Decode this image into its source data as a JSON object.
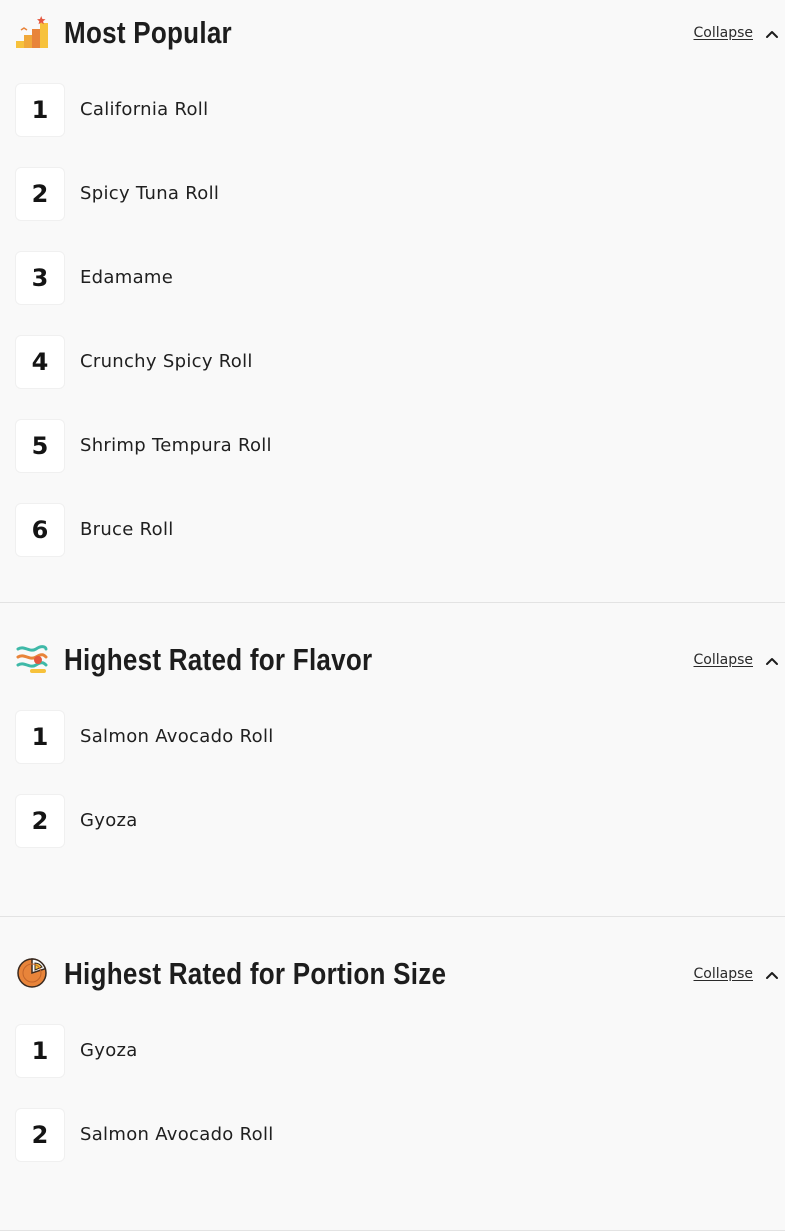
{
  "sections": [
    {
      "title": "Most Popular",
      "icon": "trophy-stairs-icon",
      "collapse_label": "Collapse",
      "items": [
        {
          "rank": "1",
          "name": "California Roll"
        },
        {
          "rank": "2",
          "name": "Spicy Tuna Roll"
        },
        {
          "rank": "3",
          "name": "Edamame"
        },
        {
          "rank": "4",
          "name": "Crunchy Spicy Roll"
        },
        {
          "rank": "5",
          "name": "Shrimp Tempura Roll"
        },
        {
          "rank": "6",
          "name": "Bruce Roll"
        }
      ]
    },
    {
      "title": "Highest Rated for Flavor",
      "icon": "flavor-waves-icon",
      "collapse_label": "Collapse",
      "items": [
        {
          "rank": "1",
          "name": "Salmon Avocado Roll"
        },
        {
          "rank": "2",
          "name": "Gyoza"
        }
      ]
    },
    {
      "title": "Highest Rated for Portion Size",
      "icon": "pie-portion-icon",
      "collapse_label": "Collapse",
      "items": [
        {
          "rank": "1",
          "name": "Gyoza"
        },
        {
          "rank": "2",
          "name": "Salmon Avocado Roll"
        }
      ]
    }
  ],
  "colors": {
    "background": "#f9f9f9",
    "rank_box": "#ffffff",
    "divider": "#e3e3e3",
    "text": "#1f1f1f",
    "icon_orange": "#e8843a",
    "icon_yellow": "#f7c23c",
    "icon_teal": "#3fb9a8",
    "icon_red": "#e4573f"
  }
}
